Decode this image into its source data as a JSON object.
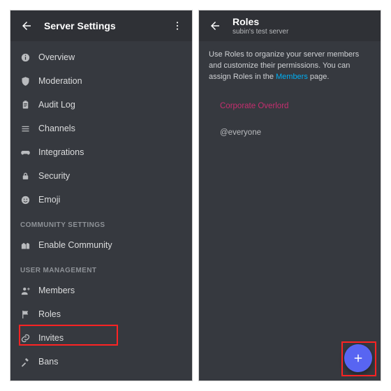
{
  "colors": {
    "accent": "#5865f2",
    "highlight": "#ff2323",
    "link": "#00aff4",
    "role_pink": "#c62e6f"
  },
  "left": {
    "title": "Server Settings",
    "nav_main": [
      {
        "id": "overview",
        "label": "Overview",
        "icon": "info-icon"
      },
      {
        "id": "moderation",
        "label": "Moderation",
        "icon": "shield-icon"
      },
      {
        "id": "audit",
        "label": "Audit Log",
        "icon": "clipboard-icon"
      },
      {
        "id": "channels",
        "label": "Channels",
        "icon": "list-icon"
      },
      {
        "id": "integrations",
        "label": "Integrations",
        "icon": "gamepad-icon"
      },
      {
        "id": "security",
        "label": "Security",
        "icon": "lock-icon"
      },
      {
        "id": "emoji",
        "label": "Emoji",
        "icon": "smile-icon"
      }
    ],
    "section_community": "COMMUNITY SETTINGS",
    "nav_community": [
      {
        "id": "enable-community",
        "label": "Enable Community",
        "icon": "town-icon"
      }
    ],
    "section_user": "USER MANAGEMENT",
    "nav_user": [
      {
        "id": "members",
        "label": "Members",
        "icon": "person-icon"
      },
      {
        "id": "roles",
        "label": "Roles",
        "icon": "flag-icon",
        "highlighted": true
      },
      {
        "id": "invites",
        "label": "Invites",
        "icon": "link-icon"
      },
      {
        "id": "bans",
        "label": "Bans",
        "icon": "hammer-icon"
      }
    ]
  },
  "right": {
    "title": "Roles",
    "subtitle": "subin's test server",
    "desc_pre": "Use Roles to organize your server members and customize their permissions. You can assign Roles in the ",
    "desc_link": "Members",
    "desc_post": " page.",
    "roles": [
      {
        "name": "Corporate Overlord",
        "color": "#c62e6f"
      },
      {
        "name": "@everyone",
        "color": "#b9bbbe"
      }
    ]
  }
}
